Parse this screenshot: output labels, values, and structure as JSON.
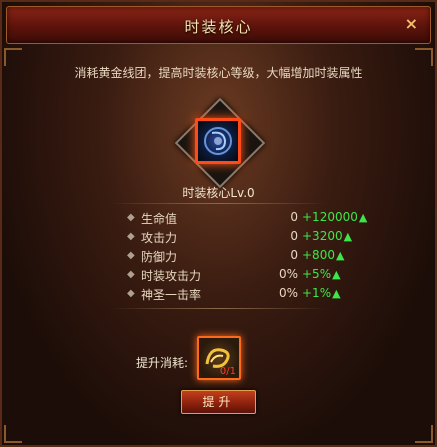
{
  "window": {
    "title": "时装核心",
    "close_label": "×"
  },
  "subtitle": "消耗黄金线团，提高时装核心等级，大幅增加时装属性",
  "core": {
    "label": "时装核心Lv.0"
  },
  "stats": [
    {
      "name": "生命值",
      "current": "0",
      "increase": "+120000"
    },
    {
      "name": "攻击力",
      "current": "0",
      "increase": "+3200"
    },
    {
      "name": "防御力",
      "current": "0",
      "increase": "+800"
    },
    {
      "name": "时装攻击力",
      "current": "0%",
      "increase": "+5%"
    },
    {
      "name": "神圣一击率",
      "current": "0%",
      "increase": "+1%"
    }
  ],
  "cost": {
    "label": "提升消耗:",
    "item_count": "0/1"
  },
  "upgrade_button": {
    "label": "提升"
  },
  "colors": {
    "increase_green": "#3fe64a",
    "title_text": "#f6e3b0",
    "accent_orange": "#ff5a1a"
  },
  "icons": {
    "core_icon": "blue-orb-icon",
    "cost_item_icon": "gold-thread-icon",
    "stat_bullet": "diamond-bullet-icon",
    "increase_arrow": "up-arrow-icon"
  }
}
